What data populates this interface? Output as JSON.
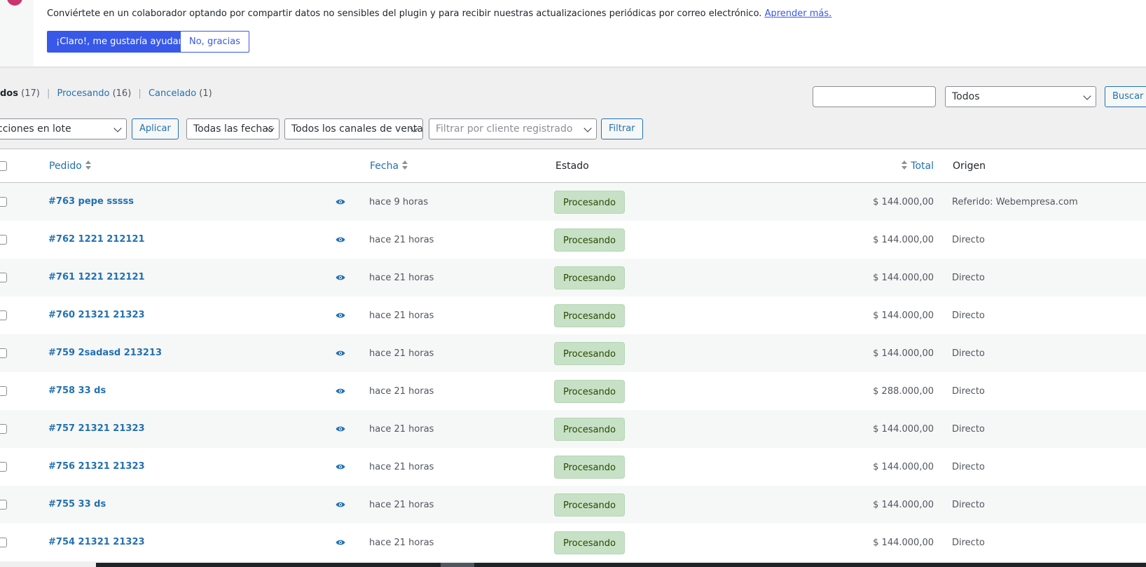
{
  "notice": {
    "text": "Conviértete en un colaborador optando por compartir datos no sensibles del plugin y para recibir nuestras actualizaciones periódicas por correo electrónico.",
    "link": "Aprender más.",
    "accept_label": "¡Claro!, me gustaría ayudar",
    "decline_label": "No, gracias"
  },
  "views": {
    "all_label": "dos",
    "all_count": "(17)",
    "processing_label": "Procesando",
    "processing_count": "(16)",
    "cancelled_label": "Cancelado",
    "cancelled_count": "(1)"
  },
  "search": {
    "status_select": "Todos",
    "button": "Buscar p"
  },
  "filters": {
    "bulk_actions": "cciones en lote",
    "apply": "Aplicar",
    "dates": "Todas las fechas",
    "channels": "Todos los canales de venta",
    "customer_placeholder": "Filtrar por cliente registrado",
    "filter": "Filtrar"
  },
  "table": {
    "headers": {
      "order": "Pedido",
      "date": "Fecha",
      "status": "Estado",
      "total": "Total",
      "origin": "Origen"
    },
    "rows": [
      {
        "order": "#763 pepe sssss",
        "date": "hace 9 horas",
        "status": "Procesando",
        "total": "$ 144.000,00",
        "origin": "Referido: Webempresa.com"
      },
      {
        "order": "#762 1221 212121",
        "date": "hace 21 horas",
        "status": "Procesando",
        "total": "$ 144.000,00",
        "origin": "Directo"
      },
      {
        "order": "#761 1221 212121",
        "date": "hace 21 horas",
        "status": "Procesando",
        "total": "$ 144.000,00",
        "origin": "Directo"
      },
      {
        "order": "#760 21321 21323",
        "date": "hace 21 horas",
        "status": "Procesando",
        "total": "$ 144.000,00",
        "origin": "Directo"
      },
      {
        "order": "#759 2sadasd 213213",
        "date": "hace 21 horas",
        "status": "Procesando",
        "total": "$ 144.000,00",
        "origin": "Directo"
      },
      {
        "order": "#758 33 ds",
        "date": "hace 21 horas",
        "status": "Procesando",
        "total": "$ 288.000,00",
        "origin": "Directo"
      },
      {
        "order": "#757 21321 21323",
        "date": "hace 21 horas",
        "status": "Procesando",
        "total": "$ 144.000,00",
        "origin": "Directo"
      },
      {
        "order": "#756 21321 21323",
        "date": "hace 21 horas",
        "status": "Procesando",
        "total": "$ 144.000,00",
        "origin": "Directo"
      },
      {
        "order": "#755 33 ds",
        "date": "hace 21 horas",
        "status": "Procesando",
        "total": "$ 144.000,00",
        "origin": "Directo"
      },
      {
        "order": "#754 21321 21323",
        "date": "hace 21 horas",
        "status": "Procesando",
        "total": "$ 144.000,00",
        "origin": "Directo"
      }
    ]
  },
  "colors": {
    "accent": "#3858e9",
    "link": "#2271b1",
    "status_processing_bg": "#c6e1c6",
    "status_processing_text": "#2c4700"
  },
  "icons": [
    "plugin-logo-icon",
    "eye-icon",
    "chevron-down-icon",
    "sort-icon"
  ]
}
